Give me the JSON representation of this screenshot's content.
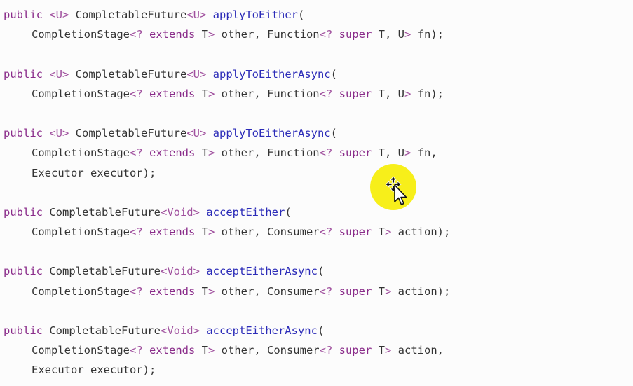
{
  "colors": {
    "background": "#fcfcfc",
    "keyword": "#8a2c8a",
    "type_param": "#a0509e",
    "method": "#2b2bb8",
    "plain": "#333333",
    "cursor_highlight": "#f7ef1a"
  },
  "code": {
    "blocks": [
      {
        "lines": [
          [
            {
              "t": "public",
              "c": "kw"
            },
            {
              "t": " ",
              "c": "pl"
            },
            {
              "t": "<U>",
              "c": "pm"
            },
            {
              "t": " CompletableFuture",
              "c": "pl"
            },
            {
              "t": "<U>",
              "c": "pm"
            },
            {
              "t": " ",
              "c": "pl"
            },
            {
              "t": "applyToEither",
              "c": "mt"
            },
            {
              "t": "(",
              "c": "pl"
            }
          ],
          [
            {
              "t": "CompletionStage",
              "c": "pl"
            },
            {
              "t": "<?",
              "c": "pm"
            },
            {
              "t": " extends",
              "c": "kw"
            },
            {
              "t": " T",
              "c": "pl"
            },
            {
              "t": ">",
              "c": "pm"
            },
            {
              "t": " other, Function",
              "c": "pl"
            },
            {
              "t": "<?",
              "c": "pm"
            },
            {
              "t": " super",
              "c": "kw"
            },
            {
              "t": " T, U",
              "c": "pl"
            },
            {
              "t": ">",
              "c": "pm"
            },
            {
              "t": " fn);",
              "c": "pl"
            }
          ]
        ]
      },
      {
        "lines": [
          [
            {
              "t": "public",
              "c": "kw"
            },
            {
              "t": " ",
              "c": "pl"
            },
            {
              "t": "<U>",
              "c": "pm"
            },
            {
              "t": " CompletableFuture",
              "c": "pl"
            },
            {
              "t": "<U>",
              "c": "pm"
            },
            {
              "t": " ",
              "c": "pl"
            },
            {
              "t": "applyToEitherAsync",
              "c": "mt"
            },
            {
              "t": "(",
              "c": "pl"
            }
          ],
          [
            {
              "t": "CompletionStage",
              "c": "pl"
            },
            {
              "t": "<?",
              "c": "pm"
            },
            {
              "t": " extends",
              "c": "kw"
            },
            {
              "t": " T",
              "c": "pl"
            },
            {
              "t": ">",
              "c": "pm"
            },
            {
              "t": " other, Function",
              "c": "pl"
            },
            {
              "t": "<?",
              "c": "pm"
            },
            {
              "t": " super",
              "c": "kw"
            },
            {
              "t": " T, U",
              "c": "pl"
            },
            {
              "t": ">",
              "c": "pm"
            },
            {
              "t": " fn);",
              "c": "pl"
            }
          ]
        ]
      },
      {
        "lines": [
          [
            {
              "t": "public",
              "c": "kw"
            },
            {
              "t": " ",
              "c": "pl"
            },
            {
              "t": "<U>",
              "c": "pm"
            },
            {
              "t": " CompletableFuture",
              "c": "pl"
            },
            {
              "t": "<U>",
              "c": "pm"
            },
            {
              "t": " ",
              "c": "pl"
            },
            {
              "t": "applyToEitherAsync",
              "c": "mt"
            },
            {
              "t": "(",
              "c": "pl"
            }
          ],
          [
            {
              "t": "CompletionStage",
              "c": "pl"
            },
            {
              "t": "<?",
              "c": "pm"
            },
            {
              "t": " extends",
              "c": "kw"
            },
            {
              "t": " T",
              "c": "pl"
            },
            {
              "t": ">",
              "c": "pm"
            },
            {
              "t": " other, Function",
              "c": "pl"
            },
            {
              "t": "<?",
              "c": "pm"
            },
            {
              "t": " super",
              "c": "kw"
            },
            {
              "t": " T, U",
              "c": "pl"
            },
            {
              "t": ">",
              "c": "pm"
            },
            {
              "t": " fn,",
              "c": "pl"
            }
          ],
          [
            {
              "t": "Executor executor);",
              "c": "pl"
            }
          ]
        ]
      },
      {
        "lines": [
          [
            {
              "t": "public",
              "c": "kw"
            },
            {
              "t": " CompletableFuture",
              "c": "pl"
            },
            {
              "t": "<Void>",
              "c": "pm"
            },
            {
              "t": " ",
              "c": "pl"
            },
            {
              "t": "acceptEither",
              "c": "mt"
            },
            {
              "t": "(",
              "c": "pl"
            }
          ],
          [
            {
              "t": "CompletionStage",
              "c": "pl"
            },
            {
              "t": "<?",
              "c": "pm"
            },
            {
              "t": " extends",
              "c": "kw"
            },
            {
              "t": " T",
              "c": "pl"
            },
            {
              "t": ">",
              "c": "pm"
            },
            {
              "t": " other, Consumer",
              "c": "pl"
            },
            {
              "t": "<?",
              "c": "pm"
            },
            {
              "t": " super",
              "c": "kw"
            },
            {
              "t": " T",
              "c": "pl"
            },
            {
              "t": ">",
              "c": "pm"
            },
            {
              "t": " action);",
              "c": "pl"
            }
          ]
        ]
      },
      {
        "lines": [
          [
            {
              "t": "public",
              "c": "kw"
            },
            {
              "t": " CompletableFuture",
              "c": "pl"
            },
            {
              "t": "<Void>",
              "c": "pm"
            },
            {
              "t": " ",
              "c": "pl"
            },
            {
              "t": "acceptEitherAsync",
              "c": "mt"
            },
            {
              "t": "(",
              "c": "pl"
            }
          ],
          [
            {
              "t": "CompletionStage",
              "c": "pl"
            },
            {
              "t": "<?",
              "c": "pm"
            },
            {
              "t": " extends",
              "c": "kw"
            },
            {
              "t": " T",
              "c": "pl"
            },
            {
              "t": ">",
              "c": "pm"
            },
            {
              "t": " other, Consumer",
              "c": "pl"
            },
            {
              "t": "<?",
              "c": "pm"
            },
            {
              "t": " super",
              "c": "kw"
            },
            {
              "t": " T",
              "c": "pl"
            },
            {
              "t": ">",
              "c": "pm"
            },
            {
              "t": " action);",
              "c": "pl"
            }
          ]
        ]
      },
      {
        "lines": [
          [
            {
              "t": "public",
              "c": "kw"
            },
            {
              "t": " CompletableFuture",
              "c": "pl"
            },
            {
              "t": "<Void>",
              "c": "pm"
            },
            {
              "t": " ",
              "c": "pl"
            },
            {
              "t": "acceptEitherAsync",
              "c": "mt"
            },
            {
              "t": "(",
              "c": "pl"
            }
          ],
          [
            {
              "t": "CompletionStage",
              "c": "pl"
            },
            {
              "t": "<?",
              "c": "pm"
            },
            {
              "t": " extends",
              "c": "kw"
            },
            {
              "t": " T",
              "c": "pl"
            },
            {
              "t": ">",
              "c": "pm"
            },
            {
              "t": " other, Consumer",
              "c": "pl"
            },
            {
              "t": "<?",
              "c": "pm"
            },
            {
              "t": " super",
              "c": "kw"
            },
            {
              "t": " T",
              "c": "pl"
            },
            {
              "t": ">",
              "c": "pm"
            },
            {
              "t": " action,",
              "c": "pl"
            }
          ],
          [
            {
              "t": "Executor executor);",
              "c": "pl"
            }
          ]
        ]
      }
    ]
  },
  "cursor": {
    "icon": "move-cursor-icon"
  }
}
